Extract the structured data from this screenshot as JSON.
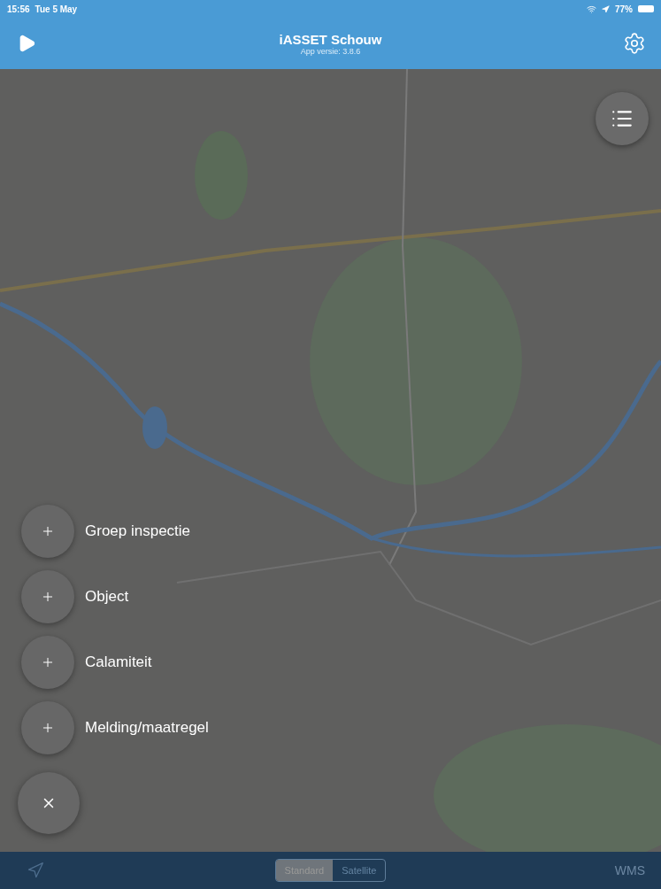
{
  "status_bar": {
    "time": "15:56",
    "date": "Tue 5 May",
    "battery": "77%"
  },
  "header": {
    "title": "iASSET Schouw",
    "subtitle": "App versie: 3.8.6"
  },
  "actions": [
    {
      "label": "Groep inspectie"
    },
    {
      "label": "Object"
    },
    {
      "label": "Calamiteit"
    },
    {
      "label": "Melding/maatregel"
    }
  ],
  "map_type": [
    {
      "label": "Standard",
      "selected": true
    },
    {
      "label": "Satellite",
      "selected": false
    }
  ],
  "wms_button": {
    "label": "WMS"
  }
}
